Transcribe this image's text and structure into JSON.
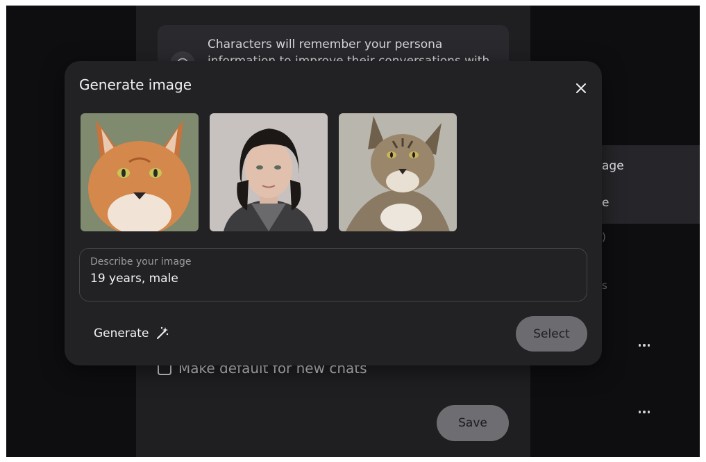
{
  "background": {
    "info_text": "Characters will remember your persona information to improve their conversations with",
    "make_default_label": "Make default for new chats",
    "save_label": "Save",
    "side_menu": {
      "item1": "age",
      "item2": "e",
      "frag1": ")",
      "frag2": "s"
    }
  },
  "modal": {
    "title": "Generate image",
    "images": [
      {
        "subject": "orange-cat-image"
      },
      {
        "subject": "young-man-portrait-image"
      },
      {
        "subject": "tabby-cat-image"
      }
    ],
    "prompt": {
      "label": "Describe your image",
      "value": "19 years, male"
    },
    "generate_label": "Generate",
    "select_label": "Select"
  },
  "colors": {
    "modal_bg": "#222225",
    "panel_bg": "#1f1f22",
    "screen_bg": "#0e0e10",
    "button_gray": "#6b6b70"
  },
  "icons": [
    "info-icon",
    "close-icon",
    "magic-wand-icon",
    "more-icon"
  ]
}
